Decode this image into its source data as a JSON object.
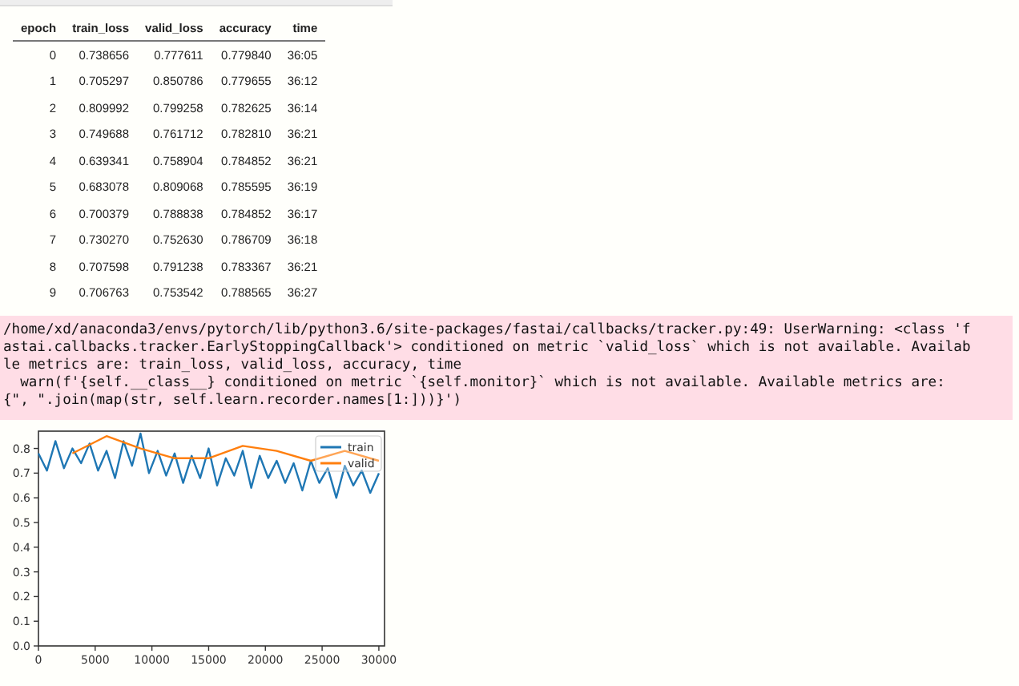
{
  "results_table": {
    "columns": [
      "epoch",
      "train_loss",
      "valid_loss",
      "accuracy",
      "time"
    ],
    "rows": [
      [
        "0",
        "0.738656",
        "0.777611",
        "0.779840",
        "36:05"
      ],
      [
        "1",
        "0.705297",
        "0.850786",
        "0.779655",
        "36:12"
      ],
      [
        "2",
        "0.809992",
        "0.799258",
        "0.782625",
        "36:14"
      ],
      [
        "3",
        "0.749688",
        "0.761712",
        "0.782810",
        "36:21"
      ],
      [
        "4",
        "0.639341",
        "0.758904",
        "0.784852",
        "36:21"
      ],
      [
        "5",
        "0.683078",
        "0.809068",
        "0.785595",
        "36:19"
      ],
      [
        "6",
        "0.700379",
        "0.788838",
        "0.784852",
        "36:17"
      ],
      [
        "7",
        "0.730270",
        "0.752630",
        "0.786709",
        "36:18"
      ],
      [
        "8",
        "0.707598",
        "0.791238",
        "0.783367",
        "36:21"
      ],
      [
        "9",
        "0.706763",
        "0.753542",
        "0.788565",
        "36:27"
      ]
    ]
  },
  "warning": {
    "text": "/home/xd/anaconda3/envs/pytorch/lib/python3.6/site-packages/fastai/callbacks/tracker.py:49: UserWarning: <class 'f\nastai.callbacks.tracker.EarlyStoppingCallback'> conditioned on metric `valid_loss` which is not available. Availab\nle metrics are: train_loss, valid_loss, accuracy, time\n  warn(f'{self.__class__} conditioned on metric `{self.monitor}` which is not available. Available metrics are:\n{\", \".join(map(str, self.learn.recorder.names[1:]))}')"
  },
  "loss_plot": {
    "chart_data": {
      "type": "line",
      "x": [
        0,
        750,
        1500,
        2250,
        3000,
        3750,
        4500,
        5250,
        6000,
        6750,
        7500,
        8250,
        9000,
        9750,
        10500,
        11250,
        12000,
        12750,
        13500,
        14250,
        15000,
        15750,
        16500,
        17250,
        18000,
        18750,
        19500,
        20250,
        21000,
        21750,
        22500,
        23250,
        24000,
        24750,
        25500,
        26250,
        27000,
        27750,
        28500,
        29250,
        30000
      ],
      "series": [
        {
          "name": "train",
          "color": "#1f77b4",
          "values": [
            0.78,
            0.71,
            0.83,
            0.72,
            0.8,
            0.74,
            0.82,
            0.71,
            0.79,
            0.68,
            0.83,
            0.73,
            0.86,
            0.7,
            0.79,
            0.69,
            0.78,
            0.66,
            0.77,
            0.68,
            0.8,
            0.65,
            0.76,
            0.69,
            0.79,
            0.64,
            0.77,
            0.68,
            0.75,
            0.66,
            0.74,
            0.63,
            0.75,
            0.66,
            0.72,
            0.6,
            0.73,
            0.65,
            0.71,
            0.62,
            0.7
          ]
        },
        {
          "name": "valid",
          "color": "#ff7f0e",
          "x": [
            3000,
            6000,
            9000,
            12000,
            15000,
            18000,
            21000,
            24000,
            27000,
            30000
          ],
          "values": [
            0.78,
            0.85,
            0.8,
            0.76,
            0.76,
            0.81,
            0.79,
            0.75,
            0.79,
            0.75
          ]
        }
      ],
      "legend": "upper right",
      "xlim": [
        0,
        30500
      ],
      "ylim": [
        0,
        0.87
      ],
      "xticks": [
        {
          "value": 0,
          "label": "0"
        },
        {
          "value": 5000,
          "label": "5000"
        },
        {
          "value": 10000,
          "label": "10000"
        },
        {
          "value": 15000,
          "label": "15000"
        },
        {
          "value": 20000,
          "label": "20000"
        },
        {
          "value": 25000,
          "label": "25000"
        },
        {
          "value": 30000,
          "label": "30000"
        }
      ],
      "yticks": [
        {
          "value": 0,
          "label": "0.0"
        },
        {
          "value": 0.1,
          "label": "0.1"
        },
        {
          "value": 0.2,
          "label": "0.2"
        },
        {
          "value": 0.3,
          "label": "0.3"
        },
        {
          "value": 0.4,
          "label": "0.4"
        },
        {
          "value": 0.5,
          "label": "0.5"
        },
        {
          "value": 0.6,
          "label": "0.6"
        },
        {
          "value": 0.7,
          "label": "0.7"
        },
        {
          "value": 0.8,
          "label": "0.8"
        }
      ]
    }
  }
}
